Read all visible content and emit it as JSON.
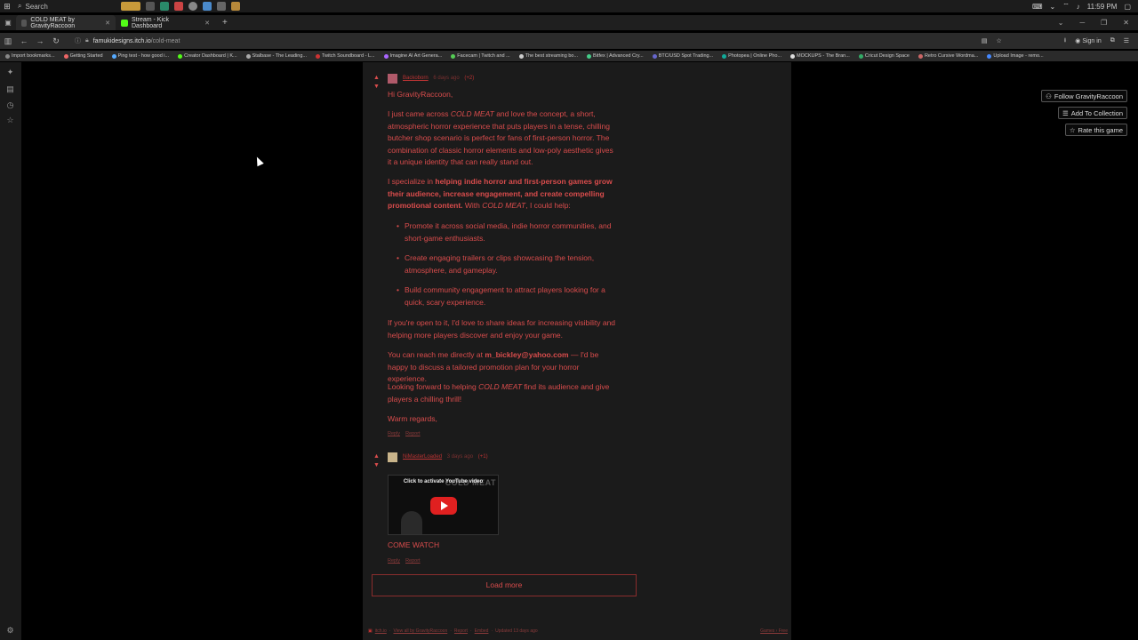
{
  "taskbar": {
    "search_label": "Search",
    "time": "11:59 PM"
  },
  "tabs": [
    {
      "title": "COLD MEAT by GravityRaccoon",
      "active": true,
      "color": "#3a3a3a"
    },
    {
      "title": "Stream - Kick Dashboard",
      "active": false,
      "color": "#53fc18"
    }
  ],
  "nav": {
    "url_domain": "famukidesigns.itch.io",
    "url_path": "/cold-meat",
    "sign_in": "Sign in"
  },
  "bookmarks": [
    {
      "label": "Import bookmarks...",
      "color": "#888"
    },
    {
      "label": "Getting Started",
      "color": "#e66"
    },
    {
      "label": "Ping test - how good i...",
      "color": "#5af"
    },
    {
      "label": "Creator Dashboard | K...",
      "color": "#53fc18"
    },
    {
      "label": "Stalbase - The Leading...",
      "color": "#aaa"
    },
    {
      "label": "Twitch Soundboard - L...",
      "color": "#c33"
    },
    {
      "label": "Imagine AI Art Genera...",
      "color": "#a6f"
    },
    {
      "label": "Facecam | Twitch and ...",
      "color": "#5c5"
    },
    {
      "label": "The best streaming bo...",
      "color": "#ccc"
    },
    {
      "label": "Bitfex | Advanced Cry...",
      "color": "#4c8"
    },
    {
      "label": "BTC/USD Spot Trading...",
      "color": "#66c"
    },
    {
      "label": "Photopea | Online Pho...",
      "color": "#1a9"
    },
    {
      "label": "MOCKUPS - The Bran...",
      "color": "#ddd"
    },
    {
      "label": "Cricut Design Space",
      "color": "#3a6"
    },
    {
      "label": "Retro Cursive Wordma...",
      "color": "#c66"
    },
    {
      "label": "Upload Image - remo...",
      "color": "#48f"
    }
  ],
  "side_buttons": {
    "follow": "Follow GravityRaccoon",
    "collection": "Add To Collection",
    "rate": "Rate this game"
  },
  "comment1": {
    "author": "Backoborn",
    "time": "6 days ago",
    "score": "(+2)",
    "greeting": "Hi GravityRaccoon,",
    "p1_a": "I just came across ",
    "p1_em": "COLD MEAT",
    "p1_b": " and love the concept, a short, atmospheric horror experience that puts players in a tense, chilling butcher shop scenario is perfect for fans of first-person horror. The combination of classic horror elements and low-poly aesthetic gives it a unique identity that can really stand out.",
    "p2_a": "I specialize in ",
    "p2_strong": "helping indie horror and first-person games grow their audience, increase engagement, and create compelling promotional content.",
    "p2_b": " With ",
    "p2_em": "COLD MEAT",
    "p2_c": ", I could help:",
    "bullets": [
      "Promote it across social media, indie horror communities, and short-game enthusiasts.",
      "Create engaging trailers or clips showcasing the tension, atmosphere, and gameplay.",
      "Build community engagement to attract players looking for a quick, scary experience."
    ],
    "p3": "If you're open to it, I'd love to share ideas for increasing visibility and helping more players discover and enjoy your game.",
    "p4_a": "You can reach me directly at ",
    "p4_strong": "m_bickley@yahoo.com",
    "p4_b": " — I'd be happy to discuss a tailored promotion plan for your horror experience.",
    "p5_a": "Looking forward to helping ",
    "p5_em": "COLD MEAT",
    "p5_b": " find its audience and give players a chilling thrill!",
    "signoff": "Warm regards,",
    "reply": "Reply",
    "report": "Report"
  },
  "comment2": {
    "author": "NiMasterLoaded",
    "time": "3 days ago",
    "score": "(+1)",
    "video_label": "Click to activate YouTube video",
    "video_watermark": "COLD MEAT",
    "text": "COME WATCH",
    "reply": "Reply",
    "report": "Report"
  },
  "load_more": "Load more",
  "footer": {
    "itchio": "itch.io",
    "view_all": "View all by GravityRaccoon",
    "report": "Report",
    "embed": "Embed",
    "updated": "Updated 13 days ago",
    "right": "Games › Free"
  }
}
